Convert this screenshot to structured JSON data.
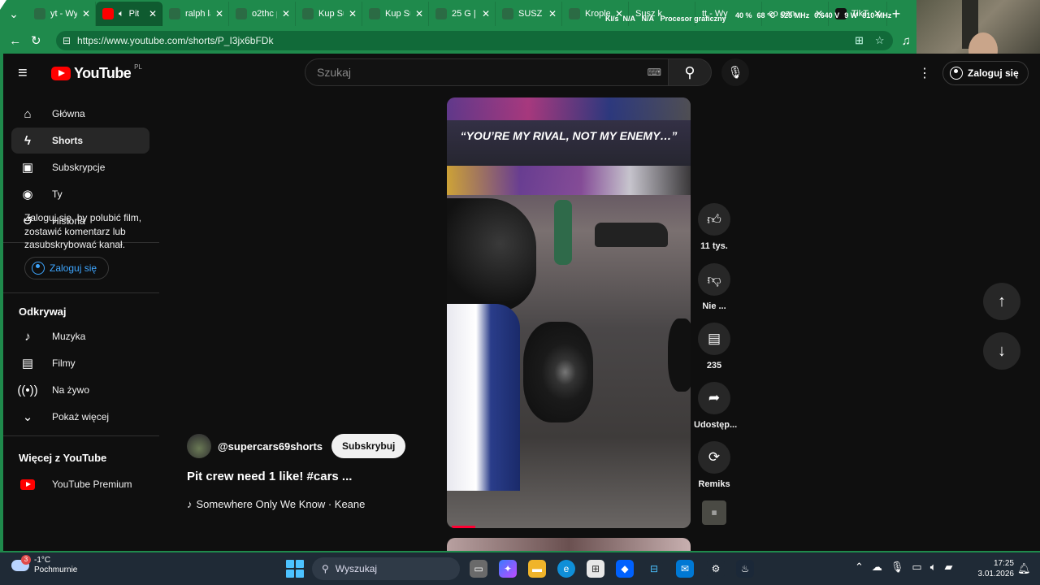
{
  "browser": {
    "tabs": [
      {
        "label": "yt - Wy",
        "active": false
      },
      {
        "label": "Pit",
        "active": true
      },
      {
        "label": "ralph la",
        "active": false
      },
      {
        "label": "o2thc p",
        "active": false
      },
      {
        "label": "Kup Su",
        "active": false
      },
      {
        "label": "Kup Su",
        "active": false
      },
      {
        "label": "25 G | S",
        "active": false
      },
      {
        "label": "SUSZ K",
        "active": false
      },
      {
        "label": "Krople",
        "active": false
      },
      {
        "label": "Susz k",
        "active": false
      },
      {
        "label": "tt - Wy",
        "active": false
      },
      {
        "label": "co ozn",
        "active": false
      },
      {
        "label": "TikTok",
        "active": false
      }
    ],
    "close_glyph": "✕",
    "new_tab_glyph": "+",
    "hw_overlay": {
      "cpu": "40 %",
      "temp": "68 °C",
      "clock": "525 MHz",
      "voltage": "0.640 V",
      "power": "9 W",
      "gpu_clock": "810 MHz",
      "label_gpu": "Procesor graficzny",
      "kbs": "KI/s",
      "na1": "N/A",
      "na2": "N/A",
      "proc": "Proc"
    },
    "url": "https://www.youtube.com/shorts/P_I3jx6bFDk"
  },
  "youtube": {
    "logo_text": "YouTube",
    "country_code": "PL",
    "search_placeholder": "Szukaj",
    "signin_label": "Zaloguj się",
    "sidebar": {
      "items": [
        {
          "label": "Główna",
          "icon": "home-icon"
        },
        {
          "label": "Shorts",
          "icon": "shorts-icon",
          "active": true
        },
        {
          "label": "Subskrypcje",
          "icon": "subscriptions-icon"
        },
        {
          "label": "Ty",
          "icon": "you-icon"
        },
        {
          "label": "Historia",
          "icon": "history-icon"
        }
      ],
      "signin_prompt": "Zaloguj się, by polubić film, zostawić komentarz lub zasubskrybować kanał.",
      "signin_label": "Zaloguj się",
      "explore_title": "Odkrywaj",
      "explore_items": [
        {
          "label": "Muzyka",
          "icon": "music-icon"
        },
        {
          "label": "Filmy",
          "icon": "movies-icon"
        },
        {
          "label": "Na żywo",
          "icon": "live-icon"
        },
        {
          "label": "Pokaż więcej",
          "icon": "chevron-down-icon"
        }
      ],
      "more_title": "Więcej z YouTube",
      "more_items": [
        {
          "label": "YouTube Premium",
          "icon": "youtube-premium-icon"
        }
      ]
    },
    "short": {
      "caption": "“YOU’RE MY RIVAL, NOT MY ENEMY…”",
      "progress": 0.1,
      "channel": "@supercars69shorts",
      "subscribe_label": "Subskrybuj",
      "title": "Pit crew need 1 like! #cars ...",
      "music": "Somewhere Only We Know · Keane",
      "actions": {
        "like": "11 tys.",
        "dislike": "Nie ...",
        "comments": "235",
        "share": "Udostęp...",
        "remix": "Remiks"
      }
    }
  },
  "taskbar": {
    "weather_temp": "-1°C",
    "weather_desc": "Pochmurnie",
    "weather_badge": "3",
    "search_label": "Wyszukaj",
    "time": "17:25",
    "date": "3.01.2026"
  }
}
